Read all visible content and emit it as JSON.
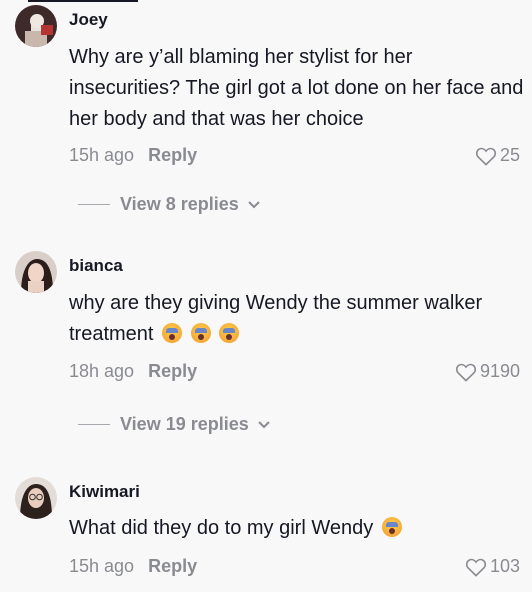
{
  "comments": [
    {
      "username": "Joey",
      "text": "Why are y’all blaming her stylist for her insecurities? The girl got a lot done on her face and her body and that was her choice",
      "emojis": [],
      "time": "15h ago",
      "reply_label": "Reply",
      "likes": "25",
      "view_replies": "View 8 replies"
    },
    {
      "username": "bianca",
      "text": "why are they giving Wendy the summer walker treatment",
      "emojis": [
        "screaming-face-emoji",
        "screaming-face-emoji",
        "screaming-face-emoji"
      ],
      "time": "18h ago",
      "reply_label": "Reply",
      "likes": "9190",
      "view_replies": "View 19 replies"
    },
    {
      "username": "Kiwimari",
      "text": "What did they do to my girl Wendy",
      "emojis": [
        "screaming-face-emoji"
      ],
      "time": "15h ago",
      "reply_label": "Reply",
      "likes": "103"
    }
  ],
  "icons": {
    "like": "heart-outline-icon",
    "expand": "chevron-down-icon"
  },
  "colors": {
    "text": "#161823",
    "secondary": "#8a8b91",
    "background": "#f8f8f8"
  }
}
